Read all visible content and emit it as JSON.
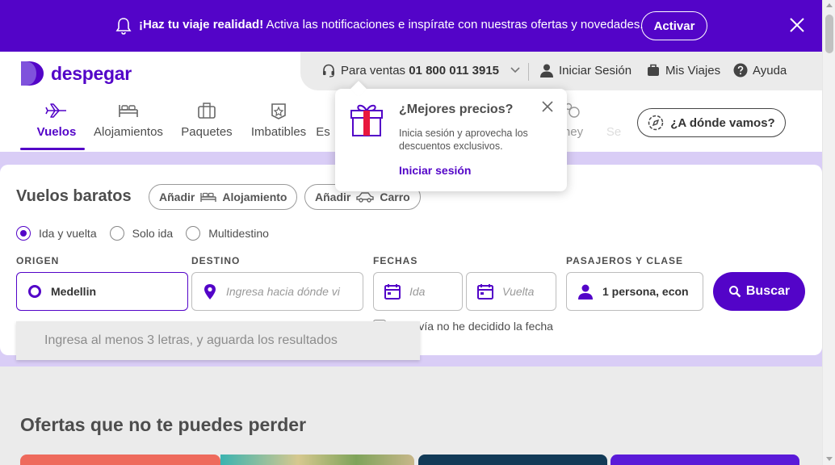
{
  "notification": {
    "bold": "¡Haz tu viaje realidad!",
    "text": " Activa las notificaciones e inspírate con nuestras ofertas y novedades.",
    "button": "Activar"
  },
  "brand": {
    "name": "despegar"
  },
  "topbar": {
    "sales_label": "Para ventas",
    "sales_phone": "01 800 011 3915",
    "login": "Iniciar Sesión",
    "trips": "Mis Viajes",
    "help": "Ayuda"
  },
  "nav": {
    "items": [
      {
        "label": "Vuelos"
      },
      {
        "label": "Alojamientos"
      },
      {
        "label": "Paquetes"
      },
      {
        "label": "Imbatibles"
      },
      {
        "label": "Es"
      },
      {
        "label": "ney"
      },
      {
        "label": "Se"
      }
    ],
    "where_button": "¿A dónde vamos?"
  },
  "popover": {
    "title": "¿Mejores precios?",
    "body": "Inicia sesión y aprovecha los descuentos exclusivos.",
    "link": "Iniciar sesión"
  },
  "search": {
    "title": "Vuelos baratos",
    "chips": [
      {
        "prefix": "Añadir",
        "label": "Alojamiento"
      },
      {
        "prefix": "Añadir",
        "label": "Carro"
      }
    ],
    "trip_types": [
      "Ida y vuelta",
      "Solo ida",
      "Multidestino"
    ],
    "selected_trip_type": "Ida y vuelta",
    "origin_label": "ORIGEN",
    "origin_value": "Medellin",
    "destination_label": "DESTINO",
    "destination_placeholder": "Ingresa hacia dónde vi",
    "dates_label": "FECHAS",
    "departure_placeholder": "Ida",
    "return_placeholder": "Vuelta",
    "pax_label": "PASAJEROS Y CLASE",
    "pax_value": "1 persona, econ",
    "search_button": "Buscar",
    "undecided_date": "Todavía no he decidido la fecha",
    "autocomplete_hint": "Ingresa al menos 3 letras, y aguarda los resultados"
  },
  "offers": {
    "title": "Ofertas que no te puedes perder"
  },
  "colors": {
    "brand": "#5304c8",
    "tint": "#d9cdf6"
  }
}
